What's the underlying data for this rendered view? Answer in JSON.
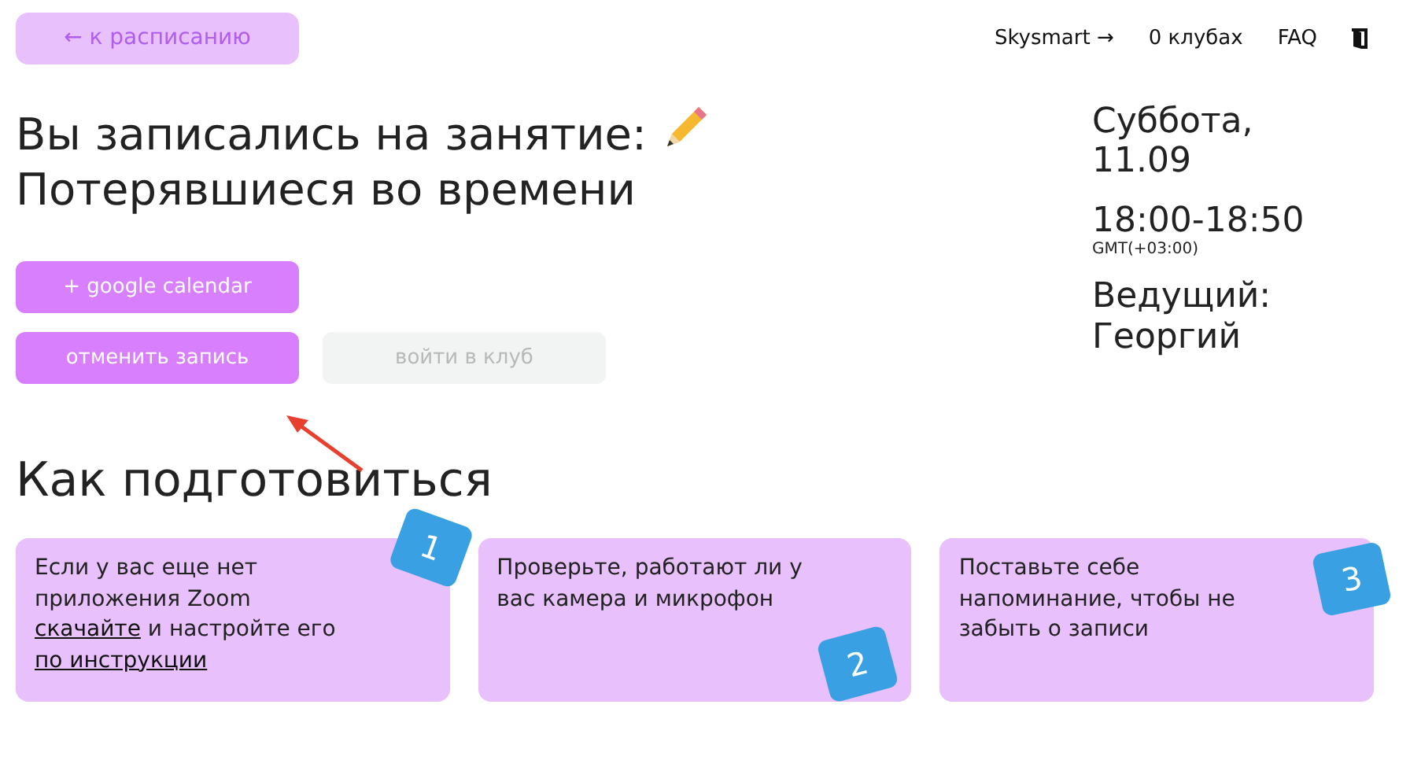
{
  "back_button": {
    "label": "← к расписанию"
  },
  "nav": [
    {
      "label": "Skysmart →"
    },
    {
      "label": "0 клубах"
    },
    {
      "label": "FAQ"
    }
  ],
  "title": {
    "line_1": "Вы записались на занятие:",
    "line_2": "Потерявшиеся во времени"
  },
  "actions": [
    {
      "label": "+ google calendar",
      "disabled": false
    },
    {
      "label": "отменить запись",
      "disabled": false
    },
    {
      "label": "войти в клуб",
      "disabled": true
    }
  ],
  "details": {
    "day": "Суббота,",
    "date": "11.09",
    "time": "18:00-18:50",
    "timezone": "GMT(+03:00)",
    "host_label": "Ведущий:",
    "host": "Георгий"
  },
  "section_title": "Как подготовиться",
  "steps": [
    {
      "number": "1",
      "parts": [
        {
          "kind": "text",
          "text": "Если у вас еще нет приложения Zoom "
        },
        {
          "kind": "link",
          "text": "скачайте"
        },
        {
          "kind": "text",
          "text": " и настройте его "
        },
        {
          "kind": "link",
          "text": "по инструкции"
        }
      ]
    },
    {
      "number": "2",
      "parts": [
        {
          "kind": "text",
          "text": "Проверьте, работают ли у вас камера и микрофон"
        }
      ]
    },
    {
      "number": "3",
      "parts": [
        {
          "kind": "text",
          "text": "Поставьте себе напоминание, чтобы не забыть о записи"
        }
      ]
    }
  ]
}
